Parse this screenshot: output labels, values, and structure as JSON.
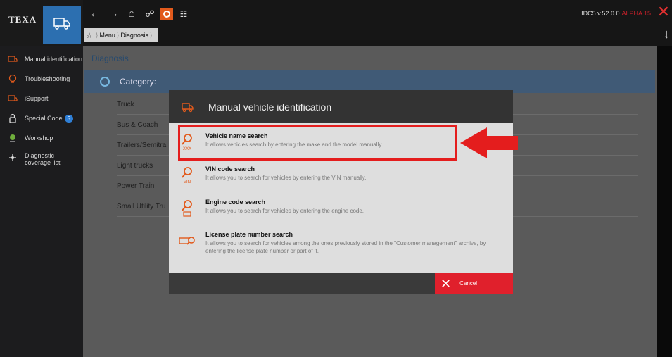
{
  "app": {
    "logo": "TEXA",
    "version": "IDC5 v.52.0.0",
    "version_tag": "ALPHA 15"
  },
  "breadcrumb": [
    "Menu",
    "Diagnosis"
  ],
  "sidebar": {
    "items": [
      {
        "label": "Manual identification",
        "icon": "vehicle-id-icon"
      },
      {
        "label": "Troubleshooting",
        "icon": "troubleshooting-icon"
      },
      {
        "label": "iSupport",
        "icon": "isupport-icon"
      },
      {
        "label": "Special Code",
        "icon": "lock-icon",
        "badge": "5"
      },
      {
        "label": "Workshop",
        "icon": "workshop-icon"
      },
      {
        "label": "Diagnostic coverage list",
        "icon": "coverage-icon"
      }
    ]
  },
  "main": {
    "title": "Diagnosis",
    "category_label": "Category:",
    "categories": [
      "Truck",
      "Bus & Coach",
      "Trailers/Semitra",
      "Light trucks",
      "Power Train",
      "Small Utility Tru"
    ]
  },
  "modal": {
    "title": "Manual vehicle identification",
    "options": [
      {
        "title": "Vehicle name search",
        "desc": "It allows vehicles search by entering the make and the model manually.",
        "icon": "vehicle-name-search-icon",
        "icon_text": "XXX"
      },
      {
        "title": "VIN code search",
        "desc": "It allows you to search for vehicles by entering the VIN manually.",
        "icon": "vin-search-icon",
        "icon_text": "VIN"
      },
      {
        "title": "Engine code search",
        "desc": "It allows you to search for vehicles by entering the engine code.",
        "icon": "engine-code-search-icon"
      },
      {
        "title": "License plate number search",
        "desc": "It allows you to search for vehicles among the ones previously stored in the \"Customer management\" archive, by entering the license plate number or part of it.",
        "icon": "license-plate-search-icon"
      }
    ],
    "cancel_label": "Cancel"
  },
  "colors": {
    "accent_orange": "#e25a1c",
    "highlight_red": "#e41d1d",
    "cancel_red": "#e0202c",
    "category_bar": "#405a76"
  }
}
